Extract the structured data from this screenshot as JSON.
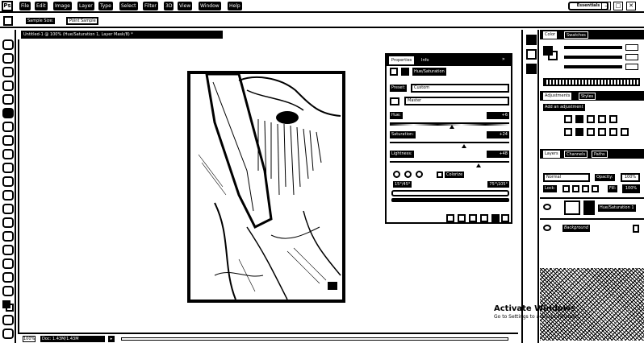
{
  "menubar": {
    "logo": "Ps",
    "items": [
      "File",
      "Edit",
      "Image",
      "Layer",
      "Type",
      "Select",
      "Filter",
      "3D",
      "View",
      "Window",
      "Help"
    ],
    "workspace": "Essentials",
    "window_controls": [
      "–",
      "□",
      "✕"
    ]
  },
  "options": {
    "sample_label": "Sample Size:",
    "sample_value": "Point Sample"
  },
  "document": {
    "tab_title": "Untitled-1 @ 100% (Hue/Saturation 1, Layer Mask/8) *",
    "zoom": "100%",
    "status": "Doc: 1.43M/1.43M"
  },
  "properties": {
    "tabs": [
      "Properties",
      "Info"
    ],
    "collapse": "»",
    "title": "Hue/Saturation",
    "preset_label": "Preset:",
    "preset_value": "Custom",
    "channel_value": "Master",
    "hue_label": "Hue:",
    "hue_value": "+6",
    "saturation_label": "Saturation:",
    "saturation_value": "+24",
    "lightness_label": "Lightness:",
    "lightness_value": "+48",
    "hue_pct": 0.52,
    "saturation_pct": 0.62,
    "lightness_pct": 0.74,
    "colorize_label": "Colorize",
    "range_left": "15°/45°",
    "range_right": "75°\\105°"
  },
  "panels": {
    "color_tabs": [
      "Color",
      "Swatches"
    ],
    "adjust_tabs": [
      "Adjustments",
      "Styles"
    ],
    "adjust_title": "Add an adjustment",
    "layers_tabs": [
      "Layers",
      "Channels",
      "Paths"
    ],
    "blend_mode": "Normal",
    "opacity_label": "Opacity:",
    "opacity_value": "100%",
    "lock_label": "Lock:",
    "fill_label": "Fill:",
    "fill_value": "100%",
    "layer1_name": "Hue/Saturation 1",
    "layer2_name": "Background"
  },
  "watermark": {
    "title": "Activate Windows",
    "subtitle": "Go to Settings to activate Windows."
  }
}
